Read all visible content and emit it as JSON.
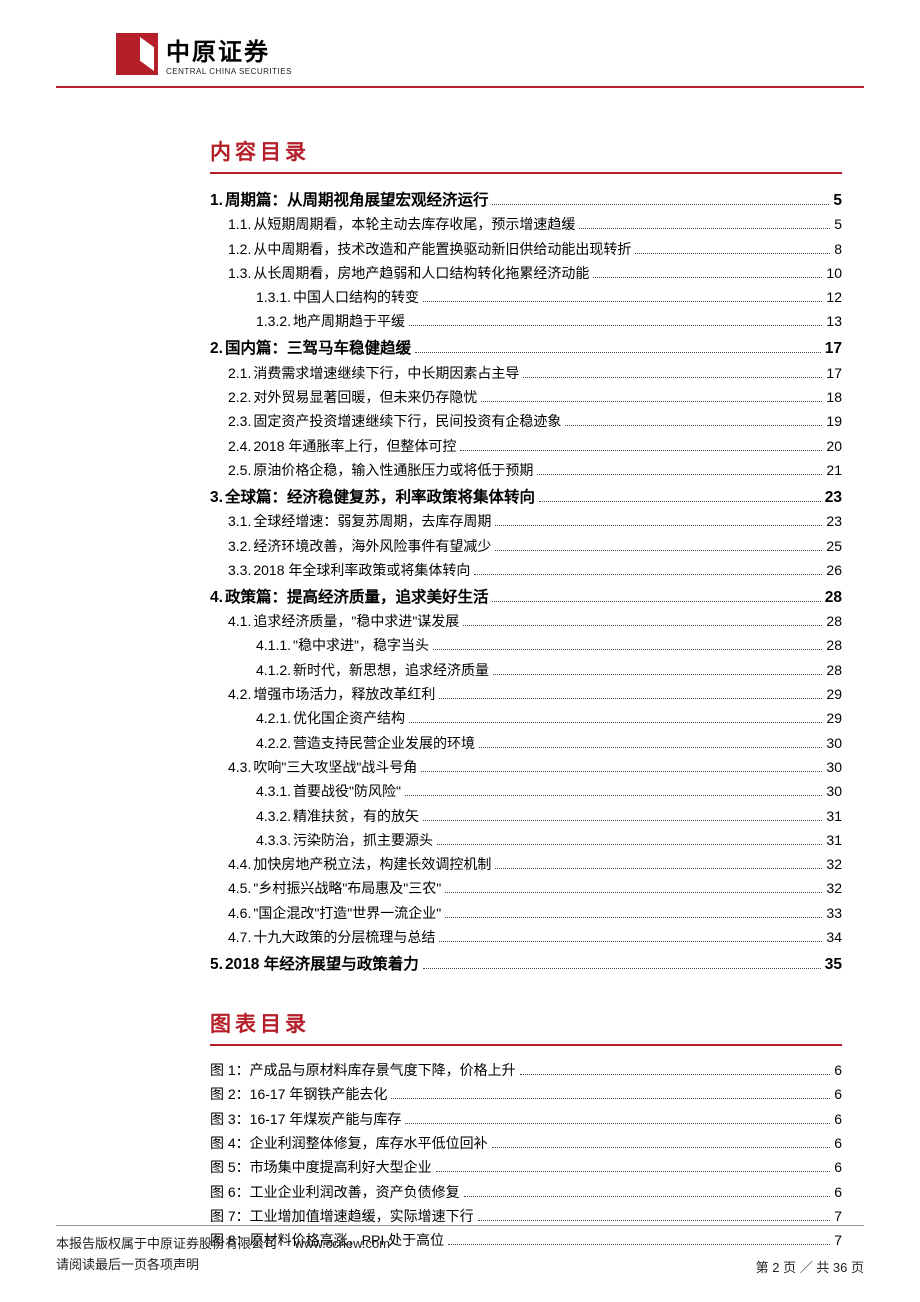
{
  "header": {
    "logo_cn": "中原证券",
    "logo_en": "CENTRAL CHINA SECURITIES"
  },
  "toc_title": "内容目录",
  "fig_title": "图表目录",
  "toc": [
    {
      "lvl": 0,
      "num": "1.",
      "label": "周期篇：从周期视角展望宏观经济运行",
      "page": "5"
    },
    {
      "lvl": 1,
      "num": "1.1.",
      "label": "从短期周期看，本轮主动去库存收尾，预示增速趋缓",
      "page": "5"
    },
    {
      "lvl": 1,
      "num": "1.2.",
      "label": "从中周期看，技术改造和产能置换驱动新旧供给动能出现转折",
      "page": "8"
    },
    {
      "lvl": 1,
      "num": "1.3.",
      "label": "从长周期看，房地产趋弱和人口结构转化拖累经济动能",
      "page": "10"
    },
    {
      "lvl": 2,
      "num": "1.3.1.",
      "label": "中国人口结构的转变",
      "page": "12"
    },
    {
      "lvl": 2,
      "num": "1.3.2.",
      "label": "地产周期趋于平缓",
      "page": "13"
    },
    {
      "lvl": 0,
      "num": "2.",
      "label": "国内篇：三驾马车稳健趋缓",
      "page": "17"
    },
    {
      "lvl": 1,
      "num": "2.1.",
      "label": "消费需求增速继续下行，中长期因素占主导",
      "page": "17"
    },
    {
      "lvl": 1,
      "num": "2.2.",
      "label": "对外贸易显著回暖，但未来仍存隐忧",
      "page": "18"
    },
    {
      "lvl": 1,
      "num": "2.3.",
      "label": "固定资产投资增速继续下行，民间投资有企稳迹象",
      "page": "19"
    },
    {
      "lvl": 1,
      "num": "2.4.",
      "label": "2018 年通胀率上行，但整体可控",
      "page": "20"
    },
    {
      "lvl": 1,
      "num": "2.5.",
      "label": "原油价格企稳，输入性通胀压力或将低于预期",
      "page": "21"
    },
    {
      "lvl": 0,
      "num": "3.",
      "label": "全球篇：经济稳健复苏，利率政策将集体转向",
      "page": "23"
    },
    {
      "lvl": 1,
      "num": "3.1.",
      "label": "全球经增速：弱复苏周期，去库存周期",
      "page": "23"
    },
    {
      "lvl": 1,
      "num": "3.2.",
      "label": "经济环境改善，海外风险事件有望减少",
      "page": "25"
    },
    {
      "lvl": 1,
      "num": "3.3.",
      "label": "2018 年全球利率政策或将集体转向",
      "page": "26"
    },
    {
      "lvl": 0,
      "num": "4.",
      "label": "政策篇：提高经济质量，追求美好生活",
      "page": "28"
    },
    {
      "lvl": 1,
      "num": "4.1.",
      "label": "追求经济质量，\"稳中求进\"谋发展",
      "page": "28"
    },
    {
      "lvl": 2,
      "num": "4.1.1.",
      "label": "\"稳中求进\"，稳字当头",
      "page": "28"
    },
    {
      "lvl": 2,
      "num": "4.1.2.",
      "label": "新时代，新思想，追求经济质量",
      "page": "28"
    },
    {
      "lvl": 1,
      "num": "4.2.",
      "label": "增强市场活力，释放改革红利",
      "page": "29"
    },
    {
      "lvl": 2,
      "num": "4.2.1.",
      "label": "优化国企资产结构",
      "page": "29"
    },
    {
      "lvl": 2,
      "num": "4.2.2.",
      "label": "营造支持民营企业发展的环境",
      "page": "30"
    },
    {
      "lvl": 1,
      "num": "4.3.",
      "label": "吹响\"三大攻坚战\"战斗号角",
      "page": "30"
    },
    {
      "lvl": 2,
      "num": "4.3.1.",
      "label": "首要战役\"防风险\"",
      "page": "30"
    },
    {
      "lvl": 2,
      "num": "4.3.2.",
      "label": "精准扶贫，有的放矢",
      "page": "31"
    },
    {
      "lvl": 2,
      "num": "4.3.3.",
      "label": "污染防治，抓主要源头",
      "page": "31"
    },
    {
      "lvl": 1,
      "num": "4.4.",
      "label": "加快房地产税立法，构建长效调控机制",
      "page": "32"
    },
    {
      "lvl": 1,
      "num": "4.5.",
      "label": "\"乡村振兴战略\"布局惠及\"三农\"",
      "page": "32"
    },
    {
      "lvl": 1,
      "num": "4.6.",
      "label": "\"国企混改\"打造\"世界一流企业\"",
      "page": "33"
    },
    {
      "lvl": 1,
      "num": "4.7.",
      "label": "十九大政策的分层梳理与总结",
      "page": "34"
    },
    {
      "lvl": 0,
      "num": "5.",
      "label": "2018 年经济展望与政策着力",
      "page": "35"
    }
  ],
  "figures": [
    {
      "num": "图 1：",
      "label": "产成品与原材料库存景气度下降，价格上升",
      "page": "6"
    },
    {
      "num": "图 2：",
      "label": "16-17 年钢铁产能去化",
      "page": "6"
    },
    {
      "num": "图 3：",
      "label": "16-17 年煤炭产能与库存",
      "page": "6"
    },
    {
      "num": "图 4：",
      "label": "企业利润整体修复，库存水平低位回补",
      "page": "6"
    },
    {
      "num": "图 5：",
      "label": "市场集中度提高利好大型企业",
      "page": "6"
    },
    {
      "num": "图 6：",
      "label": "工业企业利润改善，资产负债修复",
      "page": "6"
    },
    {
      "num": "图 7：",
      "label": "工业增加值增速趋缓，实际增速下行",
      "page": "7"
    },
    {
      "num": "图 8：",
      "label": "原材料价格高涨，PPI 处于高位",
      "page": "7"
    }
  ],
  "footer": {
    "copyright": "本报告版权属于中原证券股份有限公司",
    "website": "www.ccnew.com",
    "disclaimer": "请阅读最后一页各项声明",
    "page_label": "第 2 页 ／ 共 36 页"
  }
}
